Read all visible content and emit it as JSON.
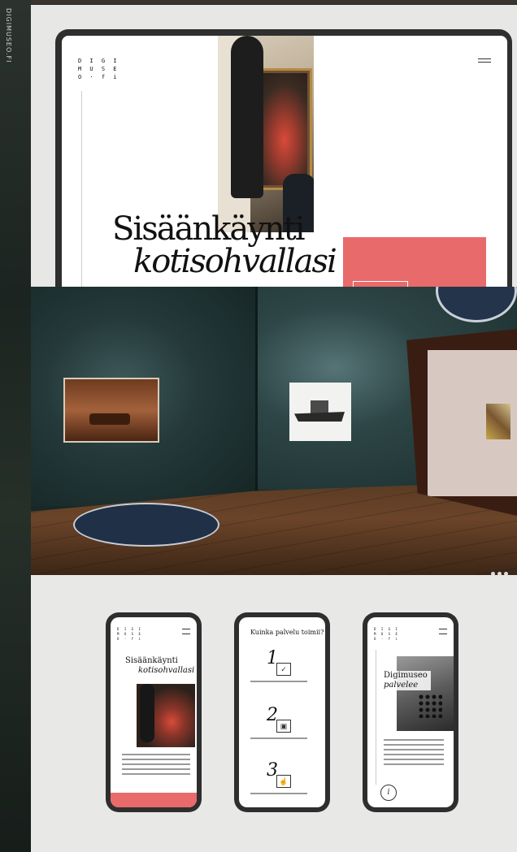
{
  "side_label": "DIGIMUSEO.FI",
  "desktop": {
    "logo": "D I G I\nM U S E\nO · f i",
    "hero_line1": "Sisäänkäynti",
    "hero_line2": "kotisohvallasi"
  },
  "mobile": {
    "logo": "D I G I\nM U S E\nO · f i",
    "p1_title_line1": "Sisäänkäynti",
    "p1_title_line2": "kotisohvallasi",
    "p2_title": "Kuinka palvelu toimii?",
    "steps": [
      "1",
      "2",
      "3"
    ],
    "p3_title_line1": "Digimuseo",
    "p3_title_line2": "palvelee",
    "p3_badge": "i"
  },
  "colors": {
    "accent_coral": "#e96a6a",
    "wall_teal": "#2e4647",
    "background_gray": "#e7e7e6"
  },
  "icons": {
    "step1": "check-icon",
    "step2": "image-icon",
    "step3": "hand-icon"
  }
}
